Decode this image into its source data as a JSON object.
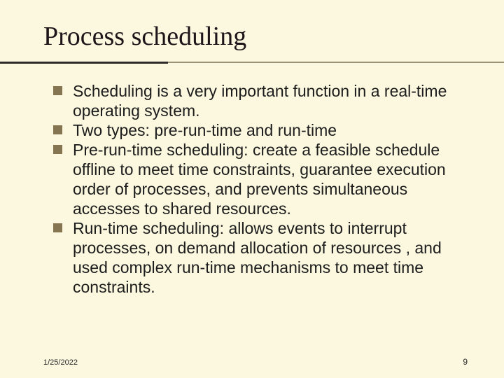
{
  "title": "Process scheduling",
  "bullets": [
    "Scheduling is a very important function in a real-time operating system.",
    "Two types: pre-run-time and run-time",
    "Pre-run-time scheduling: create a feasible schedule offline to meet time constraints, guarantee execution order of processes, and prevents simultaneous accesses to shared resources.",
    "Run-time scheduling: allows events to interrupt processes, on demand allocation of resources , and used complex run-time mechanisms to meet time constraints."
  ],
  "footer": {
    "date": "1/25/2022",
    "page": "9"
  }
}
